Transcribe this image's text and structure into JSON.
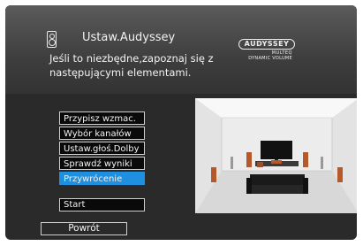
{
  "header": {
    "title": "Ustaw.Audyssey",
    "description": "Jeśli to niezbędne,zapoznaj się z następującymi elementami.",
    "logo": {
      "main": "AUDYSSEY",
      "line1": "MULTEQ",
      "line2": "DYNAMIC VOLUME"
    }
  },
  "menu": {
    "items": [
      {
        "label": "Przypisz wzmac."
      },
      {
        "label": "Wybór kanałów"
      },
      {
        "label": "Ustaw.głoś.Dolby"
      },
      {
        "label": "Sprawdź wyniki"
      },
      {
        "label": "Przywrócenie"
      }
    ],
    "selected": "Przywrócenie"
  },
  "start_button": "Start",
  "back_button": "Powrót",
  "colors": {
    "selected": "#1f8fe0",
    "background": "#2a2a2a"
  }
}
